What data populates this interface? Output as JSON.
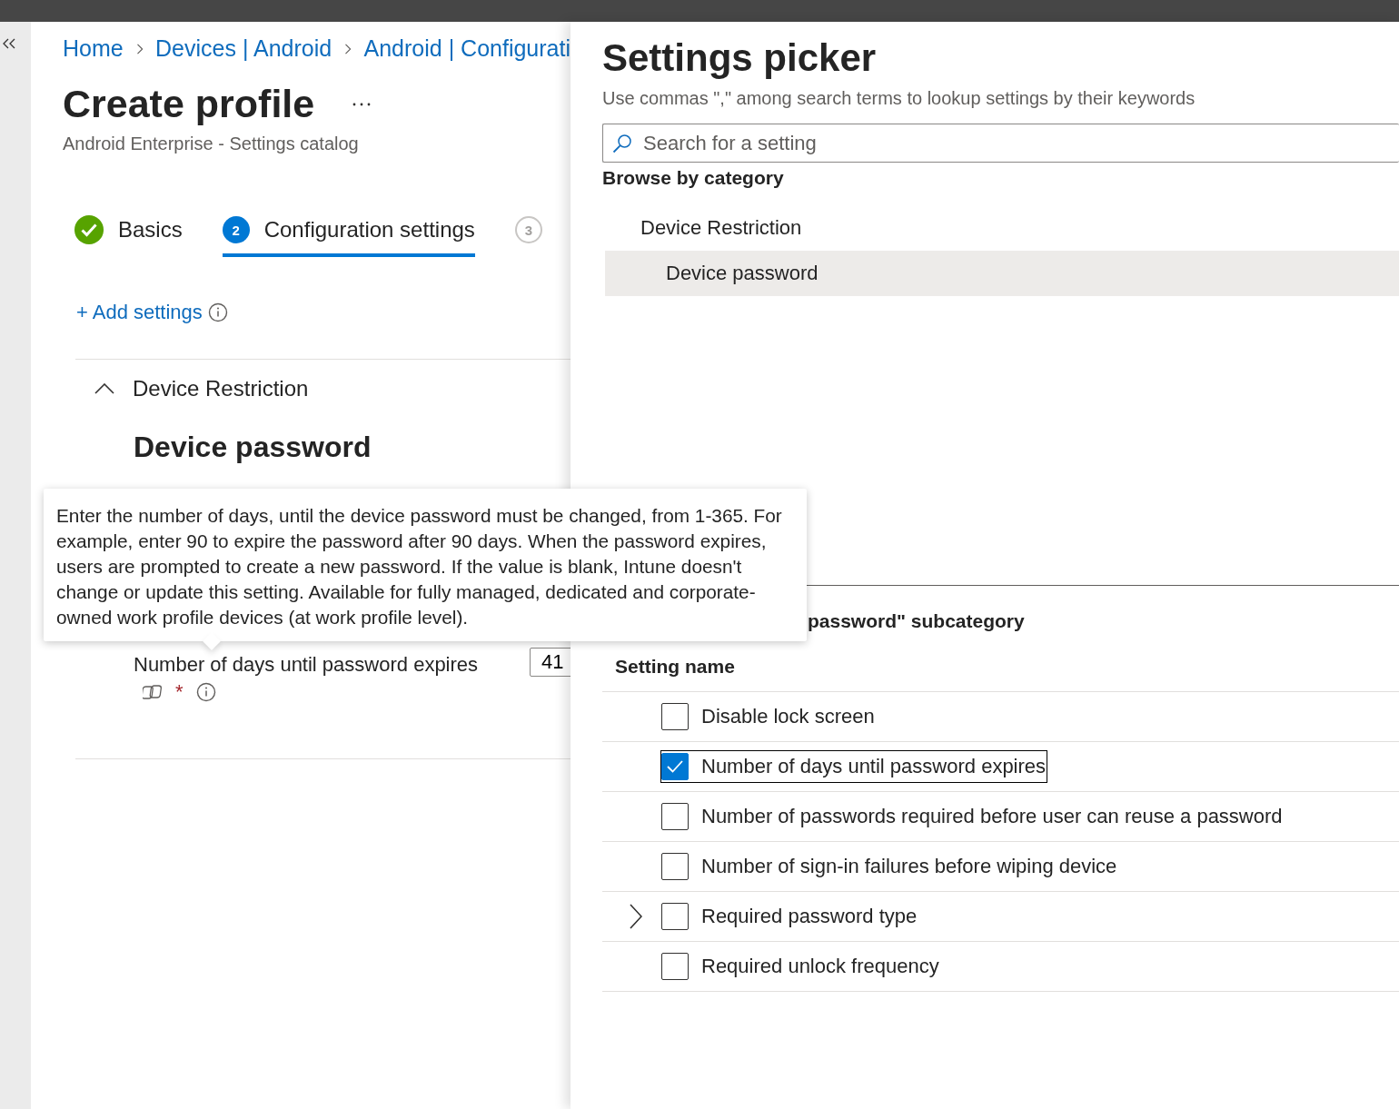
{
  "breadcrumb": [
    "Home",
    "Devices | Android",
    "Android | Configurati"
  ],
  "page": {
    "title": "Create profile",
    "subtitle": "Android Enterprise - Settings catalog"
  },
  "steps": [
    {
      "kind": "completed",
      "label": "Basics",
      "selected": false
    },
    {
      "kind": "numbered",
      "number": "2",
      "label": "Configuration settings",
      "selected": true
    },
    {
      "kind": "numbered",
      "number": "3",
      "selected": false
    }
  ],
  "add_settings": "+ Add settings",
  "section": {
    "title": "Device Restriction",
    "expanded": true,
    "subtitle": "Device password",
    "setting": {
      "label": "Number of days until password expires",
      "required_mark": "*",
      "value": "41"
    }
  },
  "tooltip": "Enter the number of days, until the device password must be changed, from 1-365. For example, enter 90 to expire the password after 90 days. When the password expires, users are prompted to create a new password. If the value is blank, Intune doesn't change or update this setting. Available for fully managed, dedicated and corporate-owned work profile devices (at work profile level).",
  "picker": {
    "title": "Settings picker",
    "description": "Use commas \",\" among search terms to lookup settings by their keywords",
    "search": {
      "placeholder": "Search for a setting"
    },
    "browse_label": "Browse by category",
    "categories": [
      {
        "label": "Device Restriction",
        "selected": false,
        "children": [
          {
            "label": "Device password",
            "selected": true
          }
        ]
      }
    ],
    "subcategory_heading": "password\" subcategory",
    "column": "Setting name",
    "settings": [
      {
        "label": "Disable lock screen",
        "checked": false,
        "focused": false,
        "expandable": false
      },
      {
        "label": "Number of days until password expires",
        "checked": true,
        "focused": true,
        "expandable": false
      },
      {
        "label": "Number of passwords required before user can reuse a password",
        "checked": false,
        "focused": false,
        "expandable": false
      },
      {
        "label": "Number of sign-in failures before wiping device",
        "checked": false,
        "focused": false,
        "expandable": false
      },
      {
        "label": "Required password type",
        "checked": false,
        "focused": false,
        "expandable": true
      },
      {
        "label": "Required unlock frequency",
        "checked": false,
        "focused": false,
        "expandable": false
      }
    ]
  }
}
